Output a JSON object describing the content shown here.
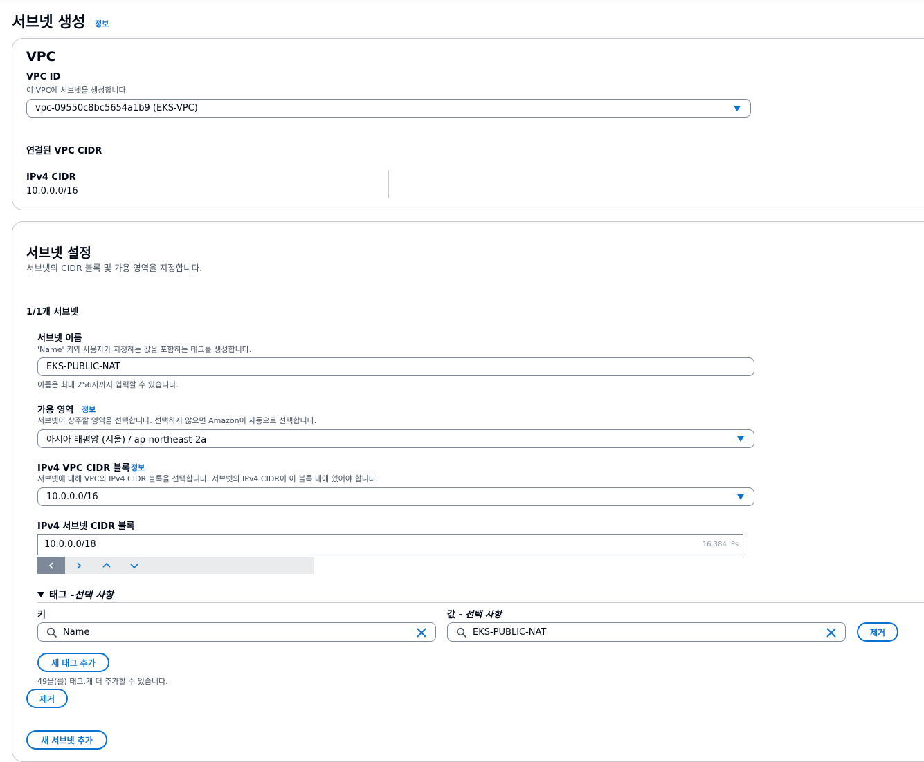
{
  "page": {
    "title": "서브넷 생성",
    "info": "정보"
  },
  "vpc": {
    "heading": "VPC",
    "vpc_id_label": "VPC ID",
    "vpc_id_desc": "이 VPC에 서브넷을 생성합니다.",
    "vpc_id_value": "vpc-09550c8bc5654a1b9 (EKS-VPC)",
    "cidr_heading": "연결된 VPC CIDR",
    "ipv4_cidr_label": "IPv4 CIDR",
    "ipv4_cidr_value": "10.0.0.0/16"
  },
  "subnet_settings": {
    "heading": "서브넷 설정",
    "desc": "서브넷의 CIDR 블록 및 가용 영역을 지정합니다.",
    "count": "1/1개 서브넷",
    "name_label": "서브넷 이름",
    "name_desc": "'Name' 키와 사용자가 지정하는 값을 포함하는 태그를 생성합니다.",
    "name_value": "EKS-PUBLIC-NAT",
    "name_hint": "이름은 최대 256자까지 입력할 수 있습니다.",
    "az_label": "가용 영역",
    "az_info": "정보",
    "az_desc": "서브넷이 상주할 영역을 선택합니다. 선택하지 않으면 Amazon이 자동으로 선택합니다.",
    "az_value": "아시아 태평양 (서울) / ap-northeast-2a",
    "vpc_cidr_label": "IPv4 VPC CIDR 블록",
    "vpc_cidr_info": "정보",
    "vpc_cidr_desc": "서브넷에 대해 VPC의 IPv4 CIDR 블록을 선택합니다. 서브넷의 IPv4 CIDR이 이 블록 내에 있어야 합니다.",
    "vpc_cidr_value": "10.0.0.0/16",
    "subnet_cidr_label": "IPv4 서브넷 CIDR 블록",
    "subnet_cidr_value": "10.0.0.0/18",
    "subnet_cidr_ips": "16,384 IPs"
  },
  "tags": {
    "toggle_label": "태그 - ",
    "toggle_optional": "선택 사항",
    "key_header": "키",
    "value_header_prefix": "값 - ",
    "value_header_optional": "선택 사항",
    "key_value": "Name",
    "value_value": "EKS-PUBLIC-NAT",
    "remove_label": "제거",
    "add_tag_label": "새 태그 추가",
    "limit_hint": "49을(를) 태그.개 더 추가할 수 있습니다."
  },
  "actions": {
    "remove_subnet_label": "제거",
    "add_subnet_label": "새 서브넷 추가"
  },
  "colors": {
    "accent": "#0972d3",
    "border": "#7d8998",
    "text": "#000716",
    "muted": "#414d5c"
  }
}
